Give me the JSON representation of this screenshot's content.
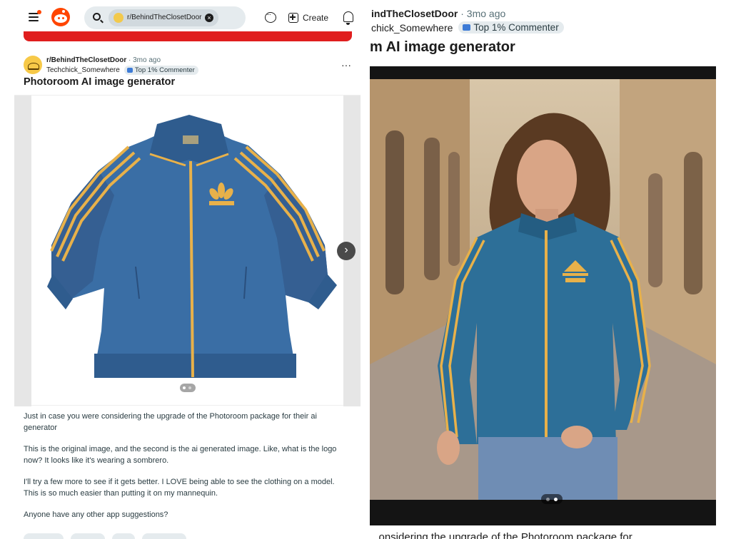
{
  "header": {
    "search_chip": "r/BehindTheClosetDoor",
    "create_label": "Create"
  },
  "post": {
    "subreddit": "r/BehindTheClosetDoor",
    "age": " · 3mo ago",
    "author": "Techchick_Somewhere",
    "badge": "Top 1% Commenter",
    "overflow": "···",
    "title": "Photoroom AI image generator",
    "body": [
      "Just in case you were considering the upgrade of the Photoroom package for their ai generator",
      "This is the original image, and the second is the ai generated image. Like, what is the logo now? It looks like it's wearing a sombrero.",
      "I'll try a few more to see if it gets better. I LOVE being able to see the clothing on a model. This is so much easier than putting it on my mannequin.",
      "Anyone have any other app suggestions?"
    ],
    "carousel": {
      "current_image": 1,
      "total_images": 2
    }
  },
  "zoomed_view": {
    "subreddit_fragment": "indTheClosetDoor",
    "age": " · 3mo ago",
    "author_fragment": "chick_Somewhere",
    "badge": "Top 1% Commenter",
    "title_fragment": "m AI image generator",
    "cut_text": "...onsidering the upgrade of the Photoroom package for",
    "carousel": {
      "current_image": 2,
      "total_images": 2
    }
  },
  "colors": {
    "accent": "#ff4500",
    "banner": "#e01e1e",
    "jacket_blue": "#3a6ea5",
    "stripe_gold": "#e8b14a",
    "badge_bg": "#e5ebee"
  },
  "icons": [
    "menu-icon",
    "reddit-logo",
    "search-icon",
    "clear-icon",
    "chat-icon",
    "create-icon",
    "bell-icon",
    "overflow-icon",
    "next-arrow-icon"
  ]
}
